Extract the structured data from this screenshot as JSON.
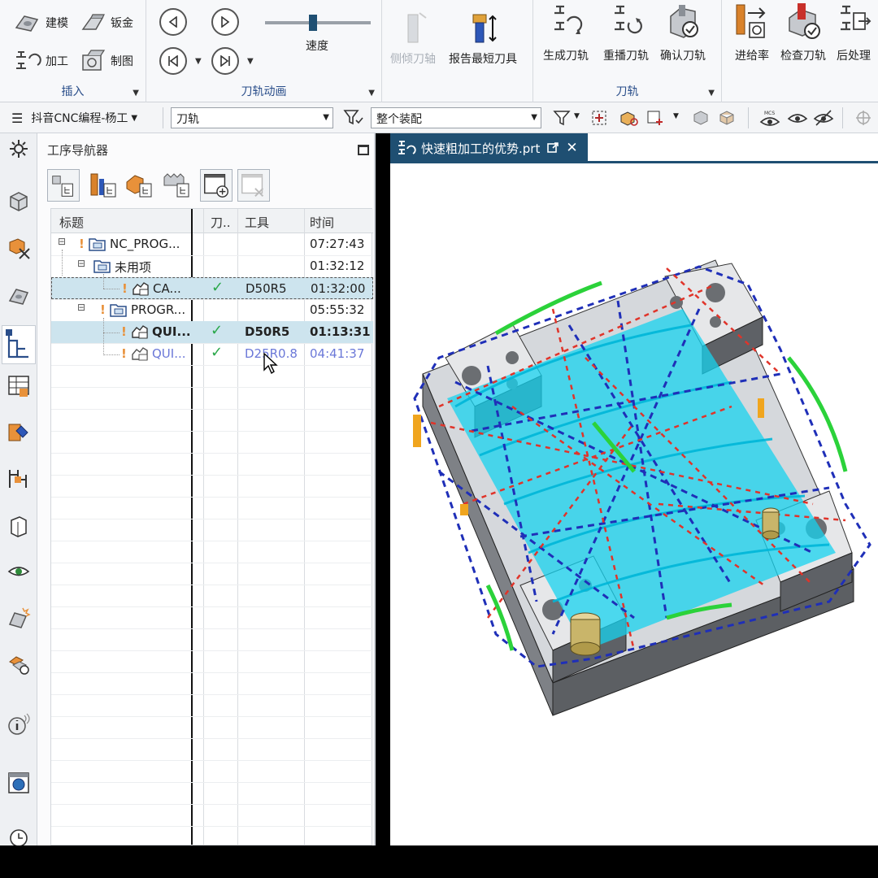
{
  "ribbon": {
    "insert_group": {
      "label": "插入",
      "buttons": [
        "建模",
        "钣金",
        "加工",
        "制图"
      ]
    },
    "animation_group": {
      "label": "刀轨动画",
      "speed_label": "速度",
      "speed_level": 0.45
    },
    "tools_group": {
      "side_tilt_label": "侧倾刀轴",
      "report_label": "报告最短刀具"
    },
    "toolpath_group": {
      "label": "刀轨",
      "generate_label": "生成刀轨",
      "replay_label": "重播刀轨",
      "verify_label": "确认刀轨"
    },
    "extra_group": {
      "feedrate_label": "进给率",
      "check_label": "检查刀轨",
      "postprocess_label": "后处理"
    }
  },
  "toolbar2": {
    "menu_label": "抖音CNC编程-杨工",
    "filter_value": "刀轨",
    "assembly_value": "整个装配"
  },
  "navigator": {
    "title": "工序导航器",
    "columns": [
      "标题",
      "刀..",
      "工具",
      "时间"
    ],
    "rows": [
      {
        "name": "NC_PROG...",
        "check": "",
        "tool": "",
        "time": "07:27:43"
      },
      {
        "name": "未用项",
        "check": "",
        "tool": "",
        "time": "01:32:12"
      },
      {
        "name": "CA...",
        "check": "✓",
        "tool": "D50R5",
        "time": "01:32:00"
      },
      {
        "name": "PROGR...",
        "check": "",
        "tool": "",
        "time": "05:55:32"
      },
      {
        "name": "QUI...",
        "check": "✓",
        "tool": "D50R5",
        "time": "01:13:31"
      },
      {
        "name": "QUI...",
        "check": "✓",
        "tool": "D25R0.8",
        "time": "04:41:37"
      }
    ]
  },
  "viewport": {
    "tab_title": "快速粗加工的优势.prt"
  },
  "colors": {
    "accent": "#1f4f72",
    "selection": "#cde4ee",
    "check_green": "#2aa84a",
    "path_blue": "#1f2fb8",
    "path_red": "#e0342a",
    "path_cyan": "#17d3ef"
  }
}
